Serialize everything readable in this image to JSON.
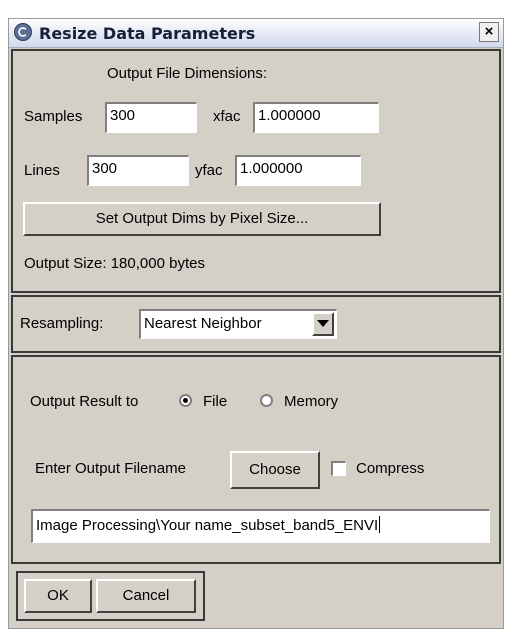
{
  "window": {
    "title": "Resize Data Parameters",
    "close_label": "×"
  },
  "dimensions": {
    "heading": "Output File Dimensions:",
    "samples_label": "Samples",
    "samples_value": "300",
    "xfac_label": "xfac",
    "xfac_value": "1.000000",
    "lines_label": "Lines",
    "lines_value": "300",
    "yfac_label": "yfac",
    "yfac_value": "1.000000",
    "pixel_size_button": "Set Output Dims by Pixel Size...",
    "output_size": "Output Size: 180,000 bytes"
  },
  "resampling": {
    "label": "Resampling:",
    "selected": "Nearest Neighbor"
  },
  "output": {
    "label": "Output Result to",
    "option_file": "File",
    "option_memory": "Memory",
    "selected": "File",
    "filename_label": "Enter Output Filename",
    "choose_button": "Choose",
    "compress_label": "Compress",
    "compress_checked": false,
    "filename_value": "Image Processing\\Your name_subset_band5_ENVI"
  },
  "actions": {
    "ok": "OK",
    "cancel": "Cancel"
  }
}
